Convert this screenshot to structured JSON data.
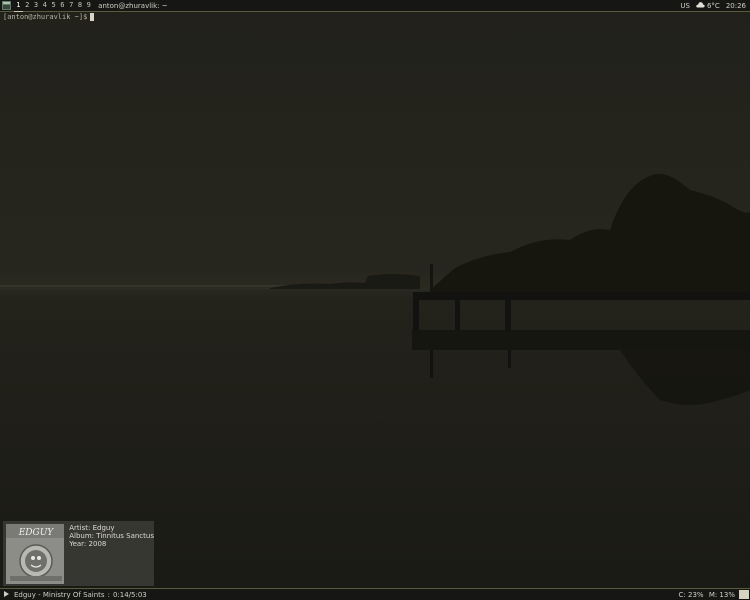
{
  "topbar": {
    "workspaces": [
      "1",
      "2",
      "3",
      "4",
      "5",
      "6",
      "7",
      "8",
      "9"
    ],
    "active_workspace": 0,
    "window_title": "anton@zhuravlik: ~",
    "keyboard_layout": "US",
    "weather_icon": "cloud-icon",
    "temperature": "6°C",
    "clock": "20:26"
  },
  "terminal": {
    "prompt": "[anton@zhuravlik ~]$"
  },
  "music_widget": {
    "artist_label": "Artist:",
    "artist": "Edguy",
    "album_label": "Album:",
    "album": "Tinnitus Sanctus",
    "year_label": "Year:",
    "year": "2008",
    "cover_logo": "EDGUY"
  },
  "bottombar": {
    "play_icon": "play-icon",
    "now_playing": "Edguy - Ministry Of Saints",
    "position": "0:14/5:03",
    "cpu": "C: 23%",
    "mem": "M: 13%"
  },
  "colors": {
    "bar_background": "#161614",
    "bar_border": "#5b5a3a",
    "sky": "#24241d",
    "water": "#1e1d17"
  }
}
